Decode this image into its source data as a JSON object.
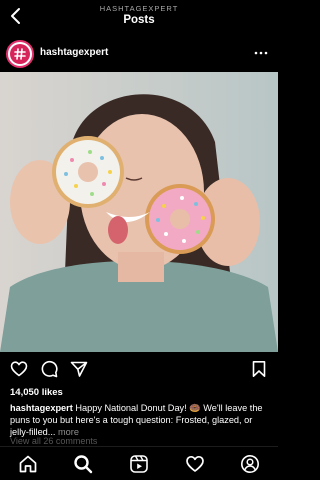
{
  "header": {
    "subtitle": "HASHTAGEXPERT",
    "title": "Posts"
  },
  "post": {
    "username": "hashtagexpert",
    "likes": "14,050 likes",
    "caption_user": "hashtagexpert",
    "caption_text": " Happy National Donut Day! 🍩  We'll leave the puns to you but here's a tough question: Frosted, glazed, or jelly-filled...",
    "caption_more": " more",
    "view_comments": "View all 26 comments"
  },
  "icons": {
    "back": "back-arrow-icon",
    "more": "more-options-icon",
    "like": "heart-icon",
    "comment": "comment-icon",
    "share": "share-icon",
    "save": "bookmark-icon",
    "tabs": [
      "home-icon",
      "search-icon",
      "reels-icon",
      "activity-heart-icon",
      "profile-icon"
    ]
  },
  "colors": {
    "background": "#000000",
    "text": "#ffffff",
    "muted": "#8e8e8e",
    "brand": "#e1306c"
  }
}
